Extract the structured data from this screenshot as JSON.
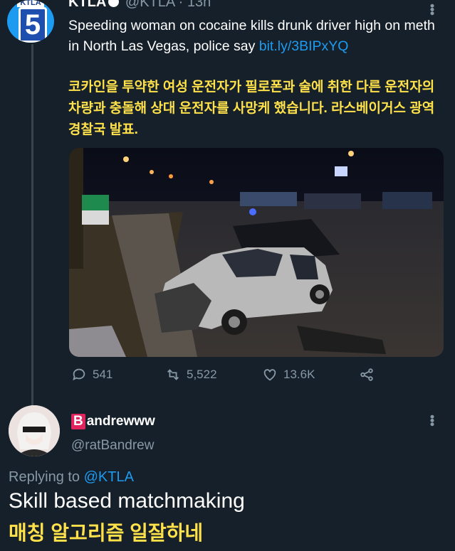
{
  "tweet": {
    "author_name": "KTLA",
    "author_handle": "@KTLA",
    "time": "13h",
    "avatar_text_top": "KTLA",
    "avatar_number": "5",
    "text": "Speeding woman on cocaine kills drunk driver high on meth in North Las Vegas, police say",
    "link": "bit.ly/3BIPxYQ",
    "translation": "코카인을 투약한 여성 운전자가 필로폰과 술에 취한 다른 운전자의 차량과 충돌해 상대 운전자를 사망케 했습니다. 라스베이거스 광역경찰국 발표.",
    "actions": {
      "replies": "541",
      "retweets": "5,522",
      "likes": "13.6K"
    }
  },
  "reply": {
    "badge_letter": "B",
    "name_rest": "andrewww",
    "handle": "@ratBandrew",
    "replying_prefix": "Replying to",
    "replying_to": "@KTLA",
    "text": "Skill based matchmaking",
    "translation": "매칭 알고리즘 일잘하네"
  },
  "colors": {
    "background": "#15202b",
    "link": "#1d9bf0",
    "muted": "#8899a6",
    "translation": "#ffe14a"
  }
}
